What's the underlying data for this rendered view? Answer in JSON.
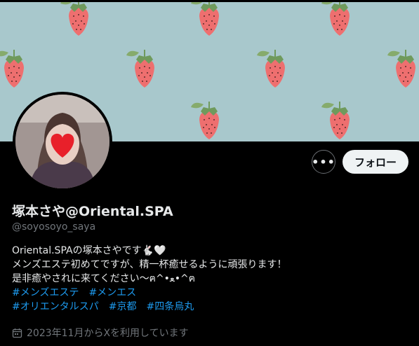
{
  "profile": {
    "display_name": "塚本さや@Oriental.SPA",
    "handle": "@soyosoyo_saya",
    "follow_label": "フォロー",
    "more_label": "•••",
    "bio_line1": "Oriental.SPAの塚本さやです🐇🤍",
    "bio_line2": "メンズエステ初めてですが、精一杯癒せるように頑張ります！",
    "bio_line3": "是非癒やされに来てください〜ฅ^•ﻌ•^ฅ",
    "hashtags_row1": [
      "#メンズエステ",
      "#メンエス"
    ],
    "hashtags_row2": [
      "#オリエンタルスパ",
      "#京都",
      "#四条烏丸"
    ],
    "joined": "2023年11月からXを利用しています"
  },
  "colors": {
    "background": "#000000",
    "banner": "#a8c8cc",
    "strawberry": "#ee6f6f",
    "leaf": "#7ea668",
    "link": "#1d9bf0",
    "muted": "#71767b"
  },
  "icons": [
    "strawberry-pattern",
    "more-icon",
    "calendar-icon"
  ]
}
